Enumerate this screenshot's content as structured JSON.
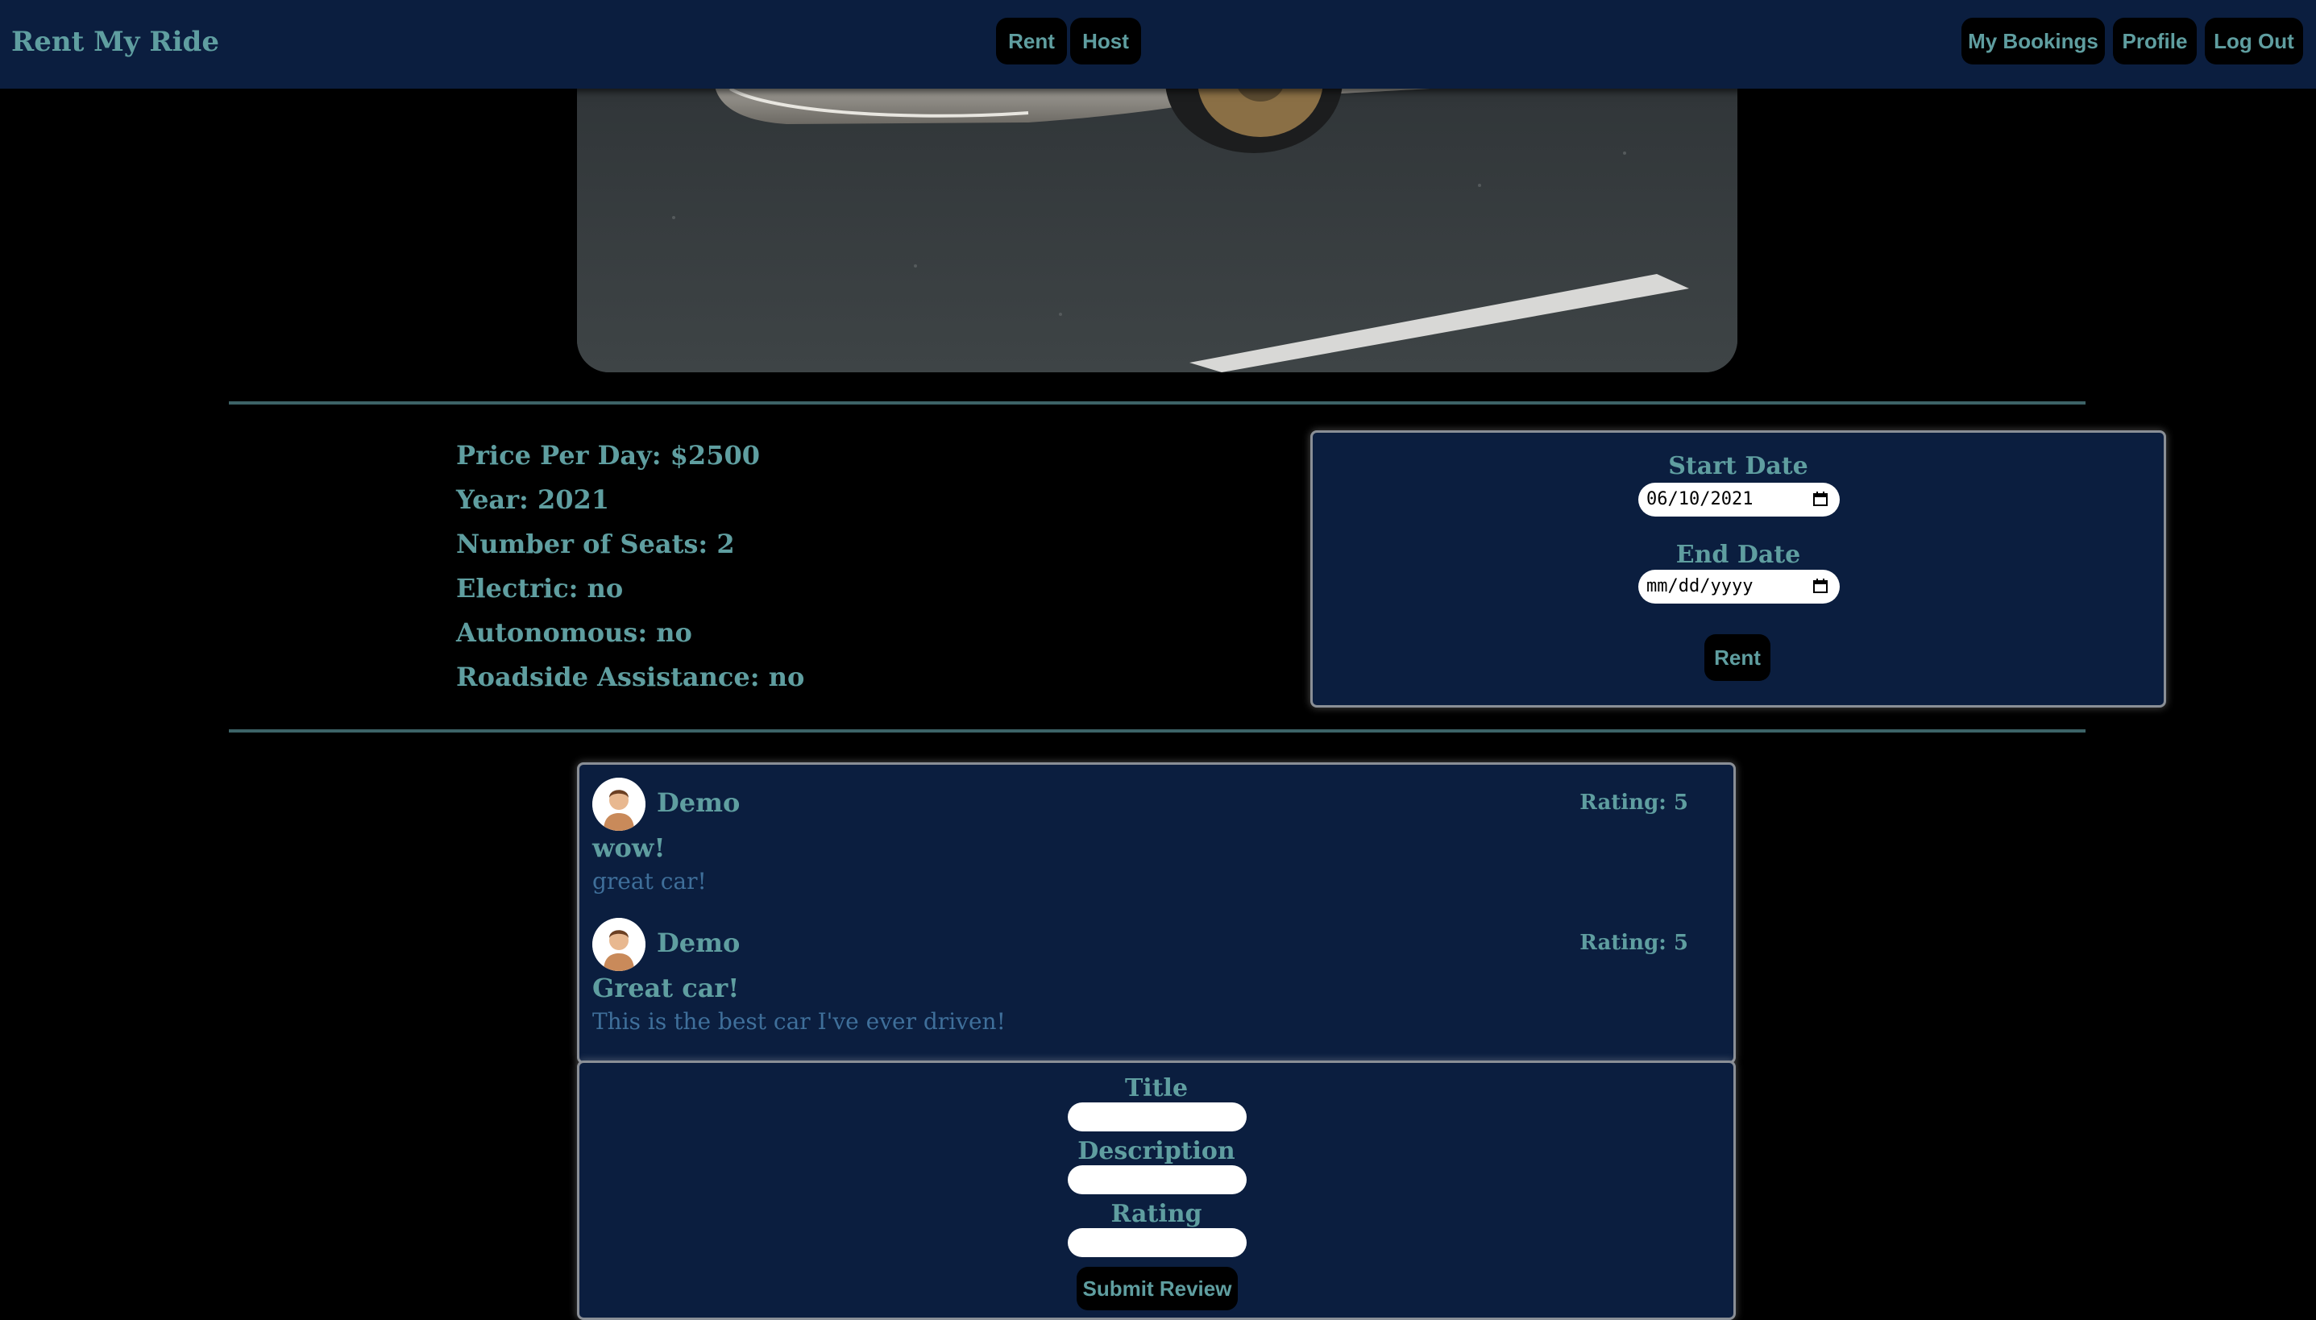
{
  "header": {
    "brand": "Rent My Ride",
    "nav": {
      "rent": "Rent",
      "host": "Host"
    },
    "user_menu": {
      "bookings": "My Bookings",
      "profile": "Profile",
      "logout": "Log Out"
    }
  },
  "car": {
    "details": [
      "Price Per Day: $2500",
      "Year: 2021",
      "Number of Seats: 2",
      "Electric: no",
      "Autonomous: no",
      "Roadside Assistance: no"
    ]
  },
  "booking": {
    "start_label": "Start Date",
    "start_value": "06/10/2021",
    "end_label": "End Date",
    "end_placeholder": "mm/dd/yyyy",
    "rent_button": "Rent"
  },
  "reviews": [
    {
      "author": "Demo",
      "rating": "Rating: 5",
      "title": "wow!",
      "body": "great car!"
    },
    {
      "author": "Demo",
      "rating": "Rating: 5",
      "title": "Great car!",
      "body": "This is the best car I've ever driven!"
    }
  ],
  "review_form": {
    "title_label": "Title",
    "description_label": "Description",
    "rating_label": "Rating",
    "submit": "Submit Review"
  },
  "colors": {
    "header_bg": "#0b1e3f",
    "accent_text": "#5f9ea0",
    "page_bg": "#000000",
    "button_bg": "#000000",
    "review_body_text": "#3f6f9a"
  },
  "icons": {
    "calendar": "calendar-icon",
    "avatar": "user-avatar-icon"
  }
}
